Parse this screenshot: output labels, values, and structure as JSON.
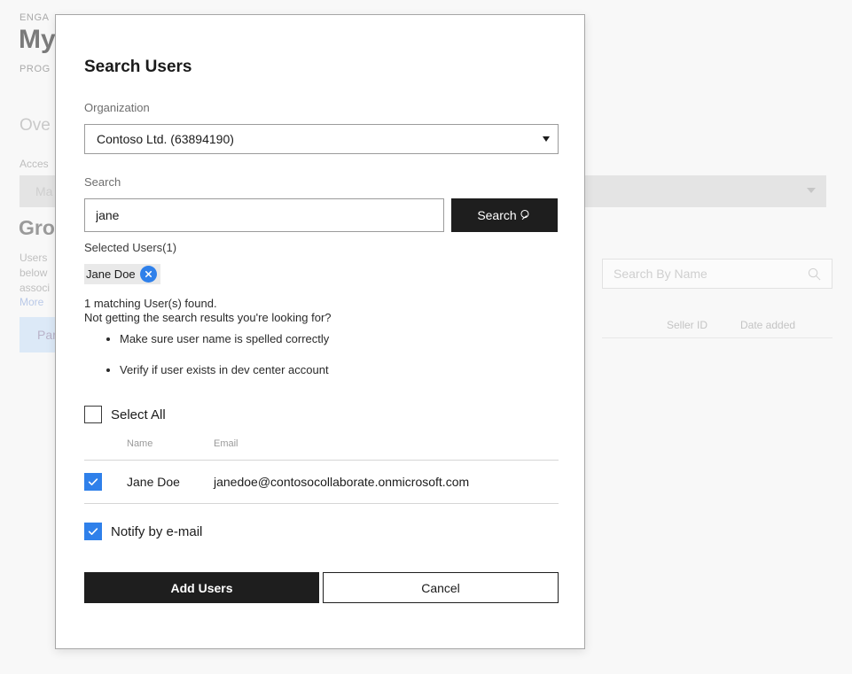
{
  "background": {
    "eyebrow": "ENGA",
    "heading": "My",
    "eyebrow2": "PROG",
    "tab_text": "Ove",
    "access_label": "Acces",
    "graybar_label": "Ma",
    "section_heading": "Gro",
    "paragraph": "Users below associ",
    "more_link": "More",
    "pivot_label": "Par",
    "search_placeholder": "Search By Name",
    "column_seller_id": "Seller ID",
    "column_date_added": "Date added"
  },
  "dialog": {
    "title": "Search Users",
    "organization": {
      "label": "Organization",
      "value": "Contoso Ltd. (63894190)"
    },
    "search": {
      "label": "Search",
      "value": "jane",
      "button_label": "Search"
    },
    "selected_users": {
      "label": "Selected Users(1)",
      "chips": [
        "Jane Doe"
      ]
    },
    "messages": {
      "found": "1 matching User(s) found.",
      "hint": "Not getting the search results you're looking for?",
      "tips": [
        "Make sure user name is spelled correctly",
        "Verify if user exists in dev center account"
      ]
    },
    "select_all": {
      "label": "Select All",
      "checked": false
    },
    "results": {
      "columns": [
        "",
        "Name",
        "Email"
      ],
      "rows": [
        {
          "checked": true,
          "name": "Jane Doe",
          "email": "janedoe@contosocollaborate.onmicrosoft.com"
        }
      ]
    },
    "notify": {
      "label": "Notify by e-mail",
      "checked": true
    },
    "actions": {
      "primary": "Add Users",
      "secondary": "Cancel"
    }
  },
  "colors": {
    "accent_blue": "#2f80ea",
    "dark_button": "#1e1e1e",
    "page_background": "#f8f8f8"
  }
}
